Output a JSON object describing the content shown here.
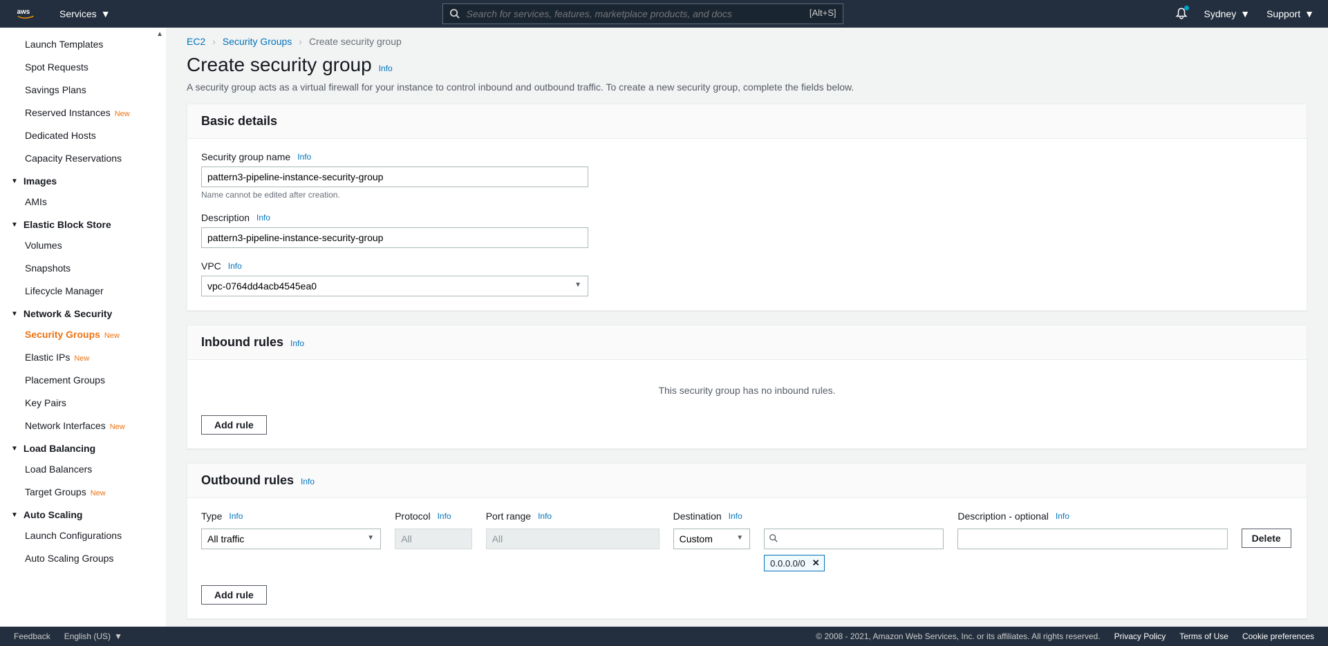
{
  "topbar": {
    "services_label": "Services",
    "search_placeholder": "Search for services, features, marketplace products, and docs",
    "search_shortcut": "[Alt+S]",
    "region_label": "Sydney",
    "support_label": "Support"
  },
  "sidebar": {
    "items_pre": [
      {
        "label": "Launch Templates"
      },
      {
        "label": "Spot Requests"
      },
      {
        "label": "Savings Plans"
      },
      {
        "label": "Reserved Instances",
        "new": true
      },
      {
        "label": "Dedicated Hosts"
      },
      {
        "label": "Capacity Reservations"
      }
    ],
    "section_images": "Images",
    "items_images": [
      {
        "label": "AMIs"
      }
    ],
    "section_ebs": "Elastic Block Store",
    "items_ebs": [
      {
        "label": "Volumes"
      },
      {
        "label": "Snapshots"
      },
      {
        "label": "Lifecycle Manager"
      }
    ],
    "section_netsec": "Network & Security",
    "items_netsec": [
      {
        "label": "Security Groups",
        "new": true,
        "active": true
      },
      {
        "label": "Elastic IPs",
        "new": true
      },
      {
        "label": "Placement Groups"
      },
      {
        "label": "Key Pairs"
      },
      {
        "label": "Network Interfaces",
        "new": true
      }
    ],
    "section_lb": "Load Balancing",
    "items_lb": [
      {
        "label": "Load Balancers"
      },
      {
        "label": "Target Groups",
        "new": true
      }
    ],
    "section_as": "Auto Scaling",
    "items_as": [
      {
        "label": "Launch Configurations"
      },
      {
        "label": "Auto Scaling Groups"
      }
    ],
    "new_text": "New"
  },
  "breadcrumb": {
    "level1": "EC2",
    "level2": "Security Groups",
    "level3": "Create security group"
  },
  "page": {
    "title": "Create security group",
    "info": "Info",
    "desc": "A security group acts as a virtual firewall for your instance to control inbound and outbound traffic. To create a new security group, complete the fields below."
  },
  "basic": {
    "header": "Basic details",
    "name_label": "Security group name",
    "name_value": "pattern3-pipeline-instance-security-group",
    "name_hint": "Name cannot be edited after creation.",
    "desc_label": "Description",
    "desc_value": "pattern3-pipeline-instance-security-group",
    "vpc_label": "VPC",
    "vpc_value": "vpc-0764dd4acb4545ea0"
  },
  "inbound": {
    "header": "Inbound rules",
    "empty": "This security group has no inbound rules.",
    "add_rule": "Add rule"
  },
  "outbound": {
    "header": "Outbound rules",
    "cols": {
      "type": "Type",
      "protocol": "Protocol",
      "port": "Port range",
      "dest": "Destination",
      "desc": "Description - optional"
    },
    "row": {
      "type_value": "All traffic",
      "protocol_value": "All",
      "port_value": "All",
      "dest_value": "Custom",
      "chip": "0.0.0.0/0",
      "delete": "Delete"
    },
    "add_rule": "Add rule"
  },
  "footer": {
    "feedback": "Feedback",
    "language": "English (US)",
    "copyright": "© 2008 - 2021, Amazon Web Services, Inc. or its affiliates. All rights reserved.",
    "links": [
      "Privacy Policy",
      "Terms of Use",
      "Cookie preferences"
    ]
  }
}
